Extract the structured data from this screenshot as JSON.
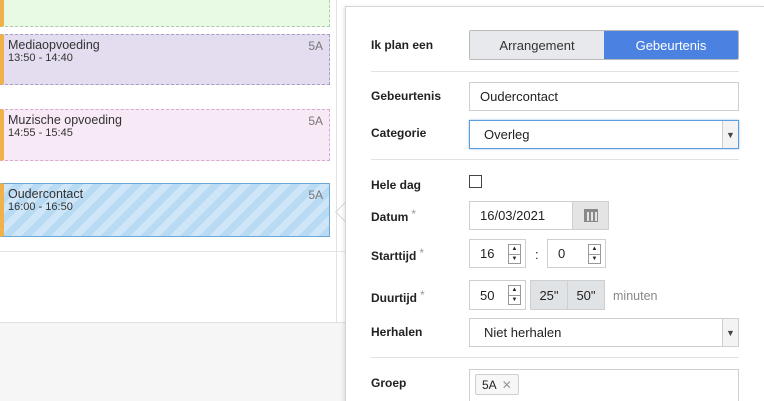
{
  "calendar": {
    "events": [
      {
        "title": "",
        "time": "",
        "group": ""
      },
      {
        "title": "Mediaopvoeding",
        "time": "13:50 - 14:40",
        "group": "5A"
      },
      {
        "title": "Muzische opvoeding",
        "time": "14:55 - 15:45",
        "group": "5A"
      },
      {
        "title": "Oudercontact",
        "time": "16:00 - 16:50",
        "group": "5A"
      }
    ]
  },
  "form": {
    "plan": {
      "label": "Ik plan een",
      "options": [
        "Arrangement",
        "Gebeurtenis"
      ],
      "selected": "Gebeurtenis"
    },
    "event": {
      "label": "Gebeurtenis",
      "value": "Oudercontact"
    },
    "category": {
      "label": "Categorie",
      "value": "Overleg"
    },
    "all_day": {
      "label": "Hele dag",
      "checked": false
    },
    "date": {
      "label": "Datum",
      "required_mark": "*",
      "value": "16/03/2021"
    },
    "start": {
      "label": "Starttijd",
      "required_mark": "*",
      "hour": "16",
      "separator": ":",
      "minute": "0"
    },
    "duration": {
      "label": "Duurtijd",
      "required_mark": "*",
      "value": "50",
      "preset_1": "25\"",
      "preset_2": "50\"",
      "unit": "minuten"
    },
    "repeat": {
      "label": "Herhalen",
      "value": "Niet herhalen"
    },
    "group": {
      "label": "Groep",
      "tags": [
        "5A"
      ],
      "remove_glyph": "✕"
    }
  },
  "colors": {
    "accent": "#4b82e2",
    "event_stripe": "#f0b04a",
    "mediaopvoeding_bg": "#e4ddf0",
    "muzische_bg": "#f8e9f6",
    "oudercontact_bg": "#cfe6f8"
  }
}
